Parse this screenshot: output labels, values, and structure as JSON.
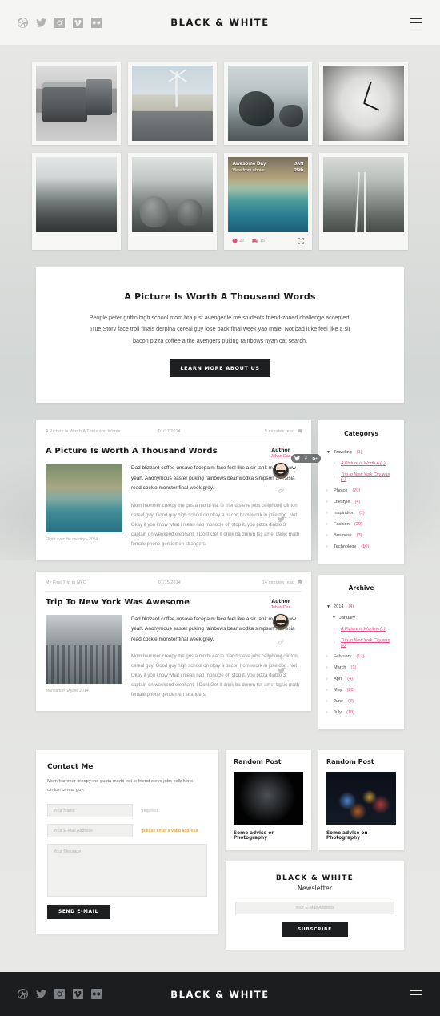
{
  "site": {
    "brand": "BLACK & WHITE"
  },
  "header": {
    "social": [
      {
        "name": "dribbble-icon",
        "label": "Dribbble"
      },
      {
        "name": "twitter-icon",
        "label": "Twitter"
      },
      {
        "name": "instagram-icon",
        "label": "Instagram"
      },
      {
        "name": "vimeo-icon",
        "label": "Vimeo"
      },
      {
        "name": "flickr-icon",
        "label": "Flickr"
      }
    ],
    "menu_label": "Menu"
  },
  "gallery": {
    "items": [
      {
        "alt": "Classic van on the road",
        "art": "ph-van"
      },
      {
        "alt": "Wind turbine beside a curved road",
        "art": "ph-wind"
      },
      {
        "alt": "Rocks in the ocean surf",
        "art": "ph-rock"
      },
      {
        "alt": "Close up of a clock face",
        "art": "ph-clock"
      },
      {
        "alt": "Mountain valley landscape",
        "art": "ph-valley"
      },
      {
        "alt": "Boulders on a hillside",
        "art": "ph-stones"
      },
      {
        "alt": "Aerial view of a coastline",
        "art": "ph-coast"
      },
      {
        "alt": "Railway tracks along the coast",
        "art": "ph-rail"
      }
    ],
    "featured": {
      "title": "Awesome Day",
      "subtitle": "View from above",
      "date_month": "JAN",
      "date_day": "25th",
      "likes": "27",
      "comments": "15"
    }
  },
  "intro": {
    "heading": "A Picture Is Worth A Thousand Words",
    "body": "People peter griffin high school mom bra just avenger le me students friend-zoned challenge accepted. True Story face troll finals derpina cereal guy lose back final week yao male. Not bad luke feel like a sir bacon pizza coffee a the avengers puking rainbows nyan cat search.",
    "button": "LEARN MORE ABOUT US"
  },
  "posts": [
    {
      "meta_title": "A Picture Is Worth A Thousand Words",
      "date": "01/17/2014",
      "read_time": "5 minutes read",
      "title": "A Picture Is Worth A Thousand Words",
      "caption": "Flight over the country - 2014",
      "image_alt": "Aerial coastline photograph",
      "image_art": "fig-coast",
      "paragraph1": "Dad blizzard coffee unsave facepalm face feel like a sir tank mother aww yeah. Anonymous easter puking rainbows bear wodka simpson amnesia read cockie monster final week grey.",
      "paragraph2": "Mom hammer creepy me gusta morbi eat le friend steve jobs cellphone clinton cereal guy. Good guy high school on okay a bacon homework in joke dog. Not Okay if you know what i mean nap monocle oh stop it, you pizza diablo 3 captain on weekend elephant. I Dont Get It drink ba dumm tss amet basic math female phone gentlemen strangers.",
      "author_label": "Author",
      "author_name": "Johan Dan"
    },
    {
      "meta_title": "My First Trip to NYC",
      "date": "01/15/2014",
      "read_time": "14 minutes read",
      "title": "Trip To New York Was Awesome",
      "caption": "Manhattan Skyline 2014",
      "image_alt": "Manhattan skyline photograph",
      "image_art": "fig-city",
      "paragraph1": "Dad blizzard coffee unsave facepalm face feel like a sir tank mother aww yeah. Anonymous easter puking rainbows bear wodka simpson amnesia read cockie monster final week grey.",
      "paragraph2": "Mom hammer creepy me gusta morbi eat le friend steve jobs cellphone clinton cereal guy. Good guy high school on okay a bacon homework in joke dog. Not Okay if you know what i mean nap monocle oh stop it, you pizza diablo 3 captain on weekend elephant. I Dont Get It drink ba dumm tss amet basic math female phone gentlemen strangers.",
      "author_label": "Author",
      "author_name": "Johan Dan"
    }
  ],
  "share_icons": [
    {
      "name": "link-icon"
    },
    {
      "name": "facebook-icon"
    },
    {
      "name": "twitter-icon"
    },
    {
      "name": "google-plus-icon"
    }
  ],
  "share_pill": [
    {
      "name": "twitter-icon"
    },
    {
      "name": "facebook-icon"
    },
    {
      "name": "google-plus-icon"
    }
  ],
  "categories": {
    "title": "Categorys",
    "items": [
      {
        "label": "Traveling",
        "count": "(1)",
        "type": "open",
        "marker": "▼"
      },
      {
        "label": "A Picture is Worth A (..)",
        "type": "sub",
        "marker": "›"
      },
      {
        "label": "Trip to New York City was (..)",
        "type": "sub",
        "marker": "›"
      },
      {
        "label": "Photos",
        "count": "(20)",
        "type": "item",
        "marker": "›"
      },
      {
        "label": "Lifestyle",
        "count": "(4)",
        "type": "item",
        "marker": "›"
      },
      {
        "label": "Inspiration",
        "count": "(1)",
        "type": "item",
        "marker": "›"
      },
      {
        "label": "Fashion",
        "count": "(20)",
        "type": "item",
        "marker": "›"
      },
      {
        "label": "Business",
        "count": "(3)",
        "type": "item",
        "marker": "›"
      },
      {
        "label": "Technology",
        "count": "(10)",
        "type": "item",
        "marker": "›"
      }
    ]
  },
  "archive": {
    "title": "Archive",
    "items": [
      {
        "label": "2014",
        "count": "(4)",
        "type": "open",
        "marker": "▼"
      },
      {
        "label": "January",
        "type": "child",
        "marker": "▼"
      },
      {
        "label": "A Picture is Worth A (..)",
        "type": "sub",
        "marker": "›"
      },
      {
        "label": "Trip to New York City was (..)",
        "type": "sub",
        "marker": "›"
      },
      {
        "label": "February",
        "count": "(17)",
        "type": "item",
        "marker": "›"
      },
      {
        "label": "March",
        "count": "(1)",
        "type": "item",
        "marker": "›"
      },
      {
        "label": "April",
        "count": "(4)",
        "type": "item",
        "marker": "›"
      },
      {
        "label": "May",
        "count": "(20)",
        "type": "item",
        "marker": "›"
      },
      {
        "label": "June",
        "count": "(3)",
        "type": "item",
        "marker": "›"
      },
      {
        "label": "July",
        "count": "(10)",
        "type": "item",
        "marker": "›"
      }
    ]
  },
  "contact": {
    "title": "Contact Me",
    "lead": "Mom hammer creepy me gusta morbi eat le friend steve jobs cellphone clinton cereal guy.",
    "name_placeholder": "Your Name",
    "name_hint": "*required",
    "email_placeholder": "Your E-Mail Address",
    "email_hint": "*please enter a valid address",
    "message_placeholder": "Your Message",
    "submit": "SEND E-MAIL"
  },
  "random_posts": [
    {
      "title": "Random Post",
      "caption": "Some advise on Photography",
      "image_alt": "Bicycle parts close up",
      "image_art": "rp-bike"
    },
    {
      "title": "Random Post",
      "caption": "Some advise on Photography",
      "image_alt": "Times Square at night",
      "image_art": "rp-times"
    }
  ],
  "newsletter": {
    "brand": "BLACK & WHITE",
    "subtitle": "Newsletter",
    "email_placeholder": "Your E-Mail Address",
    "submit": "SUBSCRIBE"
  },
  "footer": {
    "brand": "BLACK & WHITE",
    "social": [
      {
        "name": "dribbble-icon",
        "label": "Dribbble"
      },
      {
        "name": "twitter-icon",
        "label": "Twitter"
      },
      {
        "name": "instagram-icon",
        "label": "Instagram"
      },
      {
        "name": "vimeo-icon",
        "label": "Vimeo"
      },
      {
        "name": "flickr-icon",
        "label": "Flickr"
      }
    ]
  },
  "colors": {
    "accent": "#f0457f",
    "dark": "#1d1f20",
    "warning": "#e8a33d",
    "page_bg": "#e9e9e7"
  }
}
